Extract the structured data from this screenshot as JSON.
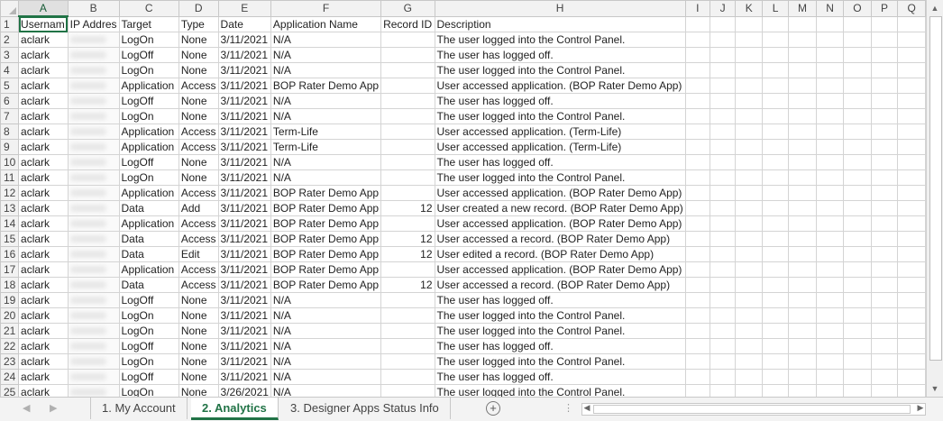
{
  "columns": [
    "A",
    "B",
    "C",
    "D",
    "E",
    "F",
    "G",
    "H",
    "I",
    "J",
    "K",
    "L",
    "M",
    "N",
    "O",
    "P",
    "Q"
  ],
  "header": [
    "Usernam",
    "IP Addres",
    "Target",
    "Type",
    "Date",
    "Application Name",
    "Record ID",
    "Description"
  ],
  "rows": [
    {
      "n": "2",
      "user": "aclark",
      "target": "LogOn",
      "type": "None",
      "date": "3/11/2021",
      "app": "N/A",
      "rec": "",
      "desc": "The user logged into the Control Panel."
    },
    {
      "n": "3",
      "user": "aclark",
      "target": "LogOff",
      "type": "None",
      "date": "3/11/2021",
      "app": "N/A",
      "rec": "",
      "desc": "The user has logged off."
    },
    {
      "n": "4",
      "user": "aclark",
      "target": "LogOn",
      "type": "None",
      "date": "3/11/2021",
      "app": "N/A",
      "rec": "",
      "desc": "The user logged into the Control Panel."
    },
    {
      "n": "5",
      "user": "aclark",
      "target": "Application",
      "type": "Access",
      "date": "3/11/2021",
      "app": "BOP Rater Demo App",
      "rec": "",
      "desc": "User accessed application. (BOP Rater Demo App)"
    },
    {
      "n": "6",
      "user": "aclark",
      "target": "LogOff",
      "type": "None",
      "date": "3/11/2021",
      "app": "N/A",
      "rec": "",
      "desc": "The user has logged off."
    },
    {
      "n": "7",
      "user": "aclark",
      "target": "LogOn",
      "type": "None",
      "date": "3/11/2021",
      "app": "N/A",
      "rec": "",
      "desc": "The user logged into the Control Panel."
    },
    {
      "n": "8",
      "user": "aclark",
      "target": "Application",
      "type": "Access",
      "date": "3/11/2021",
      "app": "Term-Life",
      "rec": "",
      "desc": "User accessed application. (Term-Life)"
    },
    {
      "n": "9",
      "user": "aclark",
      "target": "Application",
      "type": "Access",
      "date": "3/11/2021",
      "app": "Term-Life",
      "rec": "",
      "desc": "User accessed application. (Term-Life)"
    },
    {
      "n": "10",
      "user": "aclark",
      "target": "LogOff",
      "type": "None",
      "date": "3/11/2021",
      "app": "N/A",
      "rec": "",
      "desc": "The user has logged off."
    },
    {
      "n": "11",
      "user": "aclark",
      "target": "LogOn",
      "type": "None",
      "date": "3/11/2021",
      "app": "N/A",
      "rec": "",
      "desc": "The user logged into the Control Panel."
    },
    {
      "n": "12",
      "user": "aclark",
      "target": "Application",
      "type": "Access",
      "date": "3/11/2021",
      "app": "BOP Rater Demo App",
      "rec": "",
      "desc": "User accessed application. (BOP Rater Demo App)"
    },
    {
      "n": "13",
      "user": "aclark",
      "target": "Data",
      "type": "Add",
      "date": "3/11/2021",
      "app": "BOP Rater Demo App",
      "rec": "12",
      "desc": "User created a new record. (BOP Rater Demo App)"
    },
    {
      "n": "14",
      "user": "aclark",
      "target": "Application",
      "type": "Access",
      "date": "3/11/2021",
      "app": "BOP Rater Demo App",
      "rec": "",
      "desc": "User accessed application. (BOP Rater Demo App)"
    },
    {
      "n": "15",
      "user": "aclark",
      "target": "Data",
      "type": "Access",
      "date": "3/11/2021",
      "app": "BOP Rater Demo App",
      "rec": "12",
      "desc": "User accessed a record. (BOP Rater Demo App)"
    },
    {
      "n": "16",
      "user": "aclark",
      "target": "Data",
      "type": "Edit",
      "date": "3/11/2021",
      "app": "BOP Rater Demo App",
      "rec": "12",
      "desc": "User edited a record. (BOP Rater Demo App)"
    },
    {
      "n": "17",
      "user": "aclark",
      "target": "Application",
      "type": "Access",
      "date": "3/11/2021",
      "app": "BOP Rater Demo App",
      "rec": "",
      "desc": "User accessed application. (BOP Rater Demo App)"
    },
    {
      "n": "18",
      "user": "aclark",
      "target": "Data",
      "type": "Access",
      "date": "3/11/2021",
      "app": "BOP Rater Demo App",
      "rec": "12",
      "desc": "User accessed a record. (BOP Rater Demo App)"
    },
    {
      "n": "19",
      "user": "aclark",
      "target": "LogOff",
      "type": "None",
      "date": "3/11/2021",
      "app": "N/A",
      "rec": "",
      "desc": "The user has logged off."
    },
    {
      "n": "20",
      "user": "aclark",
      "target": "LogOn",
      "type": "None",
      "date": "3/11/2021",
      "app": "N/A",
      "rec": "",
      "desc": "The user logged into the Control Panel."
    },
    {
      "n": "21",
      "user": "aclark",
      "target": "LogOn",
      "type": "None",
      "date": "3/11/2021",
      "app": "N/A",
      "rec": "",
      "desc": "The user logged into the Control Panel."
    },
    {
      "n": "22",
      "user": "aclark",
      "target": "LogOff",
      "type": "None",
      "date": "3/11/2021",
      "app": "N/A",
      "rec": "",
      "desc": "The user has logged off."
    },
    {
      "n": "23",
      "user": "aclark",
      "target": "LogOn",
      "type": "None",
      "date": "3/11/2021",
      "app": "N/A",
      "rec": "",
      "desc": "The user logged into the Control Panel."
    },
    {
      "n": "24",
      "user": "aclark",
      "target": "LogOff",
      "type": "None",
      "date": "3/11/2021",
      "app": "N/A",
      "rec": "",
      "desc": "The user has logged off."
    },
    {
      "n": "25",
      "user": "aclark",
      "target": "LogOn",
      "type": "None",
      "date": "3/26/2021",
      "app": "N/A",
      "rec": "",
      "desc": "The user logged into the Control Panel."
    }
  ],
  "tabs": [
    "1. My Account",
    "2. Analytics",
    "3. Designer Apps Status Info"
  ],
  "active_tab": "2. Analytics",
  "icons": {
    "nav_prev": "triangle-left-icon",
    "nav_next": "triangle-right-icon",
    "add_sheet": "plus-circle-icon",
    "scroll_up": "triangle-up-icon",
    "scroll_down": "triangle-down-icon"
  },
  "colors": {
    "accent": "#217346",
    "header_bg": "#f2f2f2",
    "grid": "#d4d4d4"
  }
}
